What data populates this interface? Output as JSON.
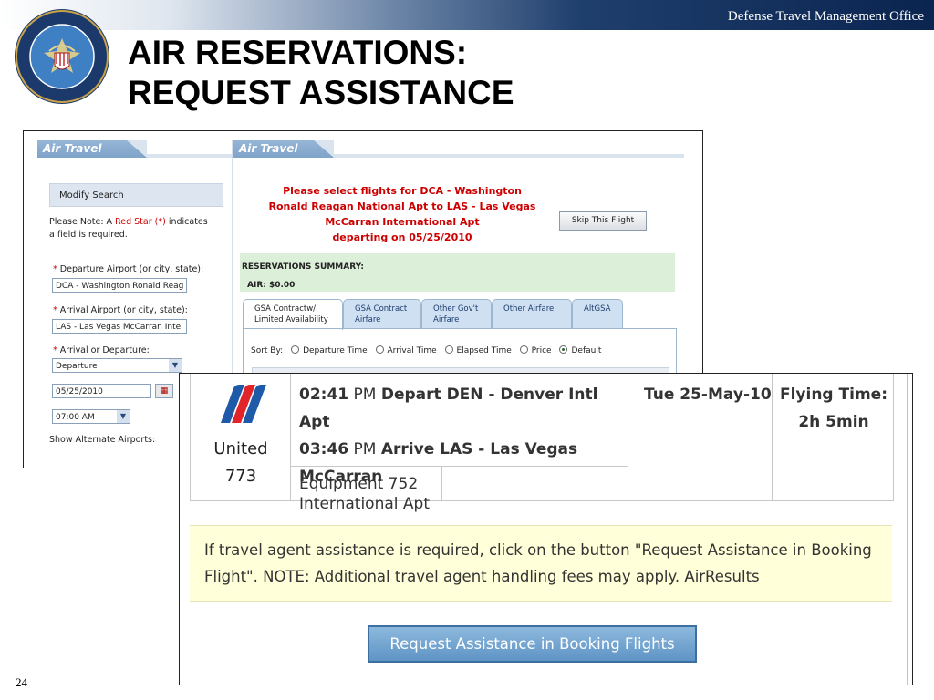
{
  "header": {
    "org": "Defense Travel Management Office",
    "title_line1": "AIR RESERVATIONS:",
    "title_line2": "REQUEST ASSISTANCE",
    "seal_text": "Defense Travel Management Office · Department of Defense"
  },
  "slide": {
    "page_number": "24"
  },
  "left_panel": {
    "header": "Air Travel",
    "modify_search": "Modify Search",
    "note_prefix": "Please Note: A ",
    "note_red": "Red Star (*)",
    "note_suffix": " indicates",
    "note_line2": "a field is required.",
    "departure_label": "Departure Airport (or city, state):",
    "departure_value": "DCA - Washington Ronald Reag",
    "arrival_label": "Arrival Airport (or city, state):",
    "arrival_value": "LAS - Las Vegas McCarran Inte",
    "arr_dep_label": "Arrival or Departure:",
    "arr_dep_value": "Departure",
    "date_value": "05/25/2010",
    "time_value": "07:00 AM",
    "alt_airports": "Show Alternate Airports:",
    "required_star": "*"
  },
  "right_panel": {
    "header": "Air Travel",
    "prompt_line1": "Please select flights for DCA - Washington",
    "prompt_line2": "Ronald Reagan National Apt to LAS - Las Vegas",
    "prompt_line3": "McCarran International Apt",
    "prompt_line4": "departing on 05/25/2010",
    "skip_button": "Skip This Flight",
    "summary_title": "RESERVATIONS SUMMARY:",
    "summary_air": "AIR:   $0.00",
    "tabs": [
      {
        "line1": "GSA Contractw/",
        "line2": "Limited Availability"
      },
      {
        "line1": "GSA Contract",
        "line2": "Airfare"
      },
      {
        "line1": "Other Gov't",
        "line2": "Airfare"
      },
      {
        "line1": "Other Airfare",
        "line2": ""
      },
      {
        "line1": "AltGSA",
        "line2": ""
      }
    ],
    "sort_by": "Sort By:",
    "sort_options": [
      "Departure Time",
      "Arrival Time",
      "Elapsed Time",
      "Price",
      "Default"
    ],
    "sort_selected": "Default"
  },
  "flight": {
    "airline": "United",
    "flight_number": "773",
    "depart_time": "02:41",
    "depart_ampm": "PM",
    "depart_text": "Depart DEN - Denver Intl Apt",
    "arrive_time": "03:46",
    "arrive_ampm": "PM",
    "arrive_text": "Arrive LAS - Las Vegas McCarran",
    "arrive_text2": "International Apt",
    "date": "Tue 25-May-10",
    "flying_time_label": "Flying Time:",
    "flying_time_value": "2h 5min",
    "equipment": "Equipment 752"
  },
  "notice": {
    "line1": "If travel agent assistance is required, click on the button \"Request Assistance in Booking",
    "line2": "Flight\". NOTE: Additional travel agent handling fees may apply. AirResults"
  },
  "request_button": "Request Assistance in Booking Flights",
  "colors": {
    "prompt_red": "#cc0000",
    "header_blue": "#0b2450",
    "tab_blue": "#cfe0f2",
    "notice_yellow": "#ffffd9",
    "button_blue": "#5e94c5"
  }
}
